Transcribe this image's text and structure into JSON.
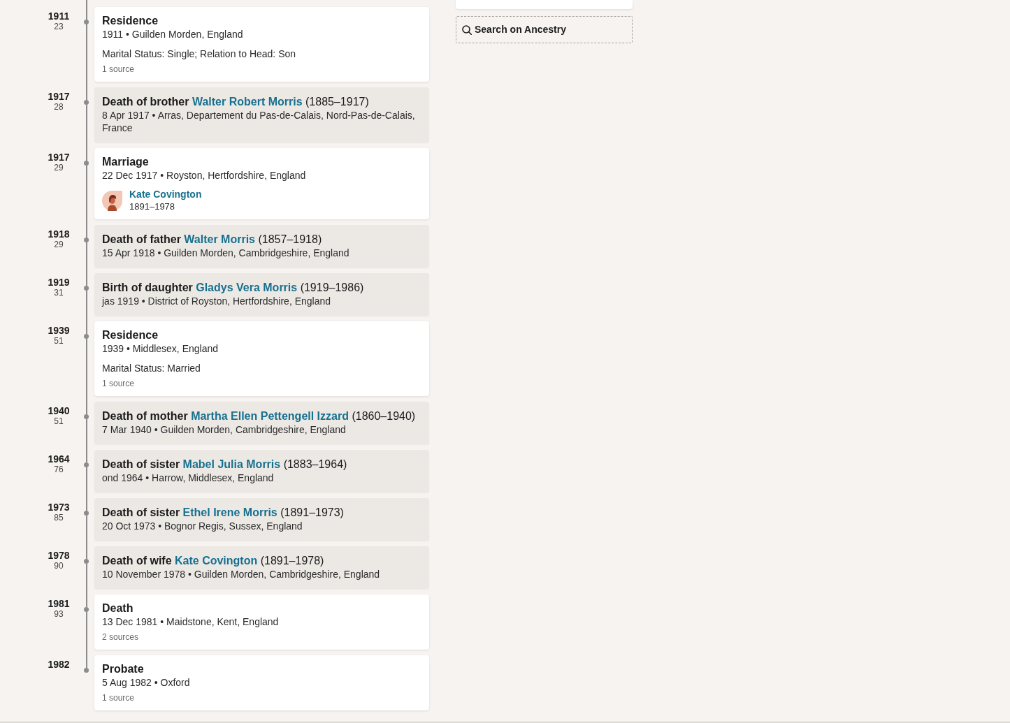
{
  "timeline": {
    "events": [
      {
        "kind": "personal",
        "year": "1911",
        "age": "23",
        "title": "Residence",
        "line": "1911 • Guilden Morden, England",
        "detail": "Marital Status: Single; Relation to Head: Son",
        "sources": "1 source"
      },
      {
        "kind": "family",
        "year": "1917",
        "age": "28",
        "relation": "Death of brother",
        "person": "Walter Robert Morris",
        "years": "(1885–1917)",
        "line": "8 Apr 1917 • Arras, Departement du Pas-de-Calais, Nord-Pas-de-Calais, France"
      },
      {
        "kind": "personal",
        "year": "1917",
        "age": "29",
        "title": "Marriage",
        "line": "22 Dec 1917 • Royston, Hertfordshire, England",
        "spouse": {
          "name": "Kate Covington",
          "years": "1891–1978"
        }
      },
      {
        "kind": "family",
        "year": "1918",
        "age": "29",
        "relation": "Death of father",
        "person": "Walter Morris",
        "years": "(1857–1918)",
        "line": "15 Apr 1918 • Guilden Morden, Cambridgeshire, England"
      },
      {
        "kind": "family",
        "year": "1919",
        "age": "31",
        "relation": "Birth of daughter",
        "person": "Gladys Vera Morris",
        "years": "(1919–1986)",
        "line": "jas 1919 • District of Royston, Hertfordshire, England"
      },
      {
        "kind": "personal",
        "year": "1939",
        "age": "51",
        "title": "Residence",
        "line": "1939 • Middlesex, England",
        "detail": "Marital Status: Married",
        "sources": "1 source"
      },
      {
        "kind": "family",
        "year": "1940",
        "age": "51",
        "relation": "Death of mother",
        "person": "Martha Ellen Pettengell Izzard",
        "years": "(1860–1940)",
        "line": "7 Mar 1940 • Guilden Morden, Cambridgeshire, England"
      },
      {
        "kind": "family",
        "year": "1964",
        "age": "76",
        "relation": "Death of sister",
        "person": "Mabel Julia Morris",
        "years": "(1883–1964)",
        "line": "ond 1964 • Harrow, Middlesex, England"
      },
      {
        "kind": "family",
        "year": "1973",
        "age": "85",
        "relation": "Death of sister",
        "person": "Ethel Irene Morris",
        "years": "(1891–1973)",
        "line": "20 Oct 1973 • Bognor Regis, Sussex, England"
      },
      {
        "kind": "family",
        "year": "1978",
        "age": "90",
        "relation": "Death of wife",
        "person": "Kate Covington",
        "years": "(1891–1978)",
        "line": "10 November 1978 • Guilden Morden, Cambridgeshire, England"
      },
      {
        "kind": "personal",
        "year": "1981",
        "age": "93",
        "title": "Death",
        "line": "13 Dec 1981 • Maidstone, Kent, England",
        "sources": "2 sources"
      },
      {
        "kind": "personal",
        "year": "1982",
        "title": "Probate",
        "line": "5 Aug 1982 • Oxford",
        "sources": "1 source"
      }
    ]
  },
  "side_panel": {
    "search_button": {
      "label": "Search on Ancestry"
    }
  }
}
